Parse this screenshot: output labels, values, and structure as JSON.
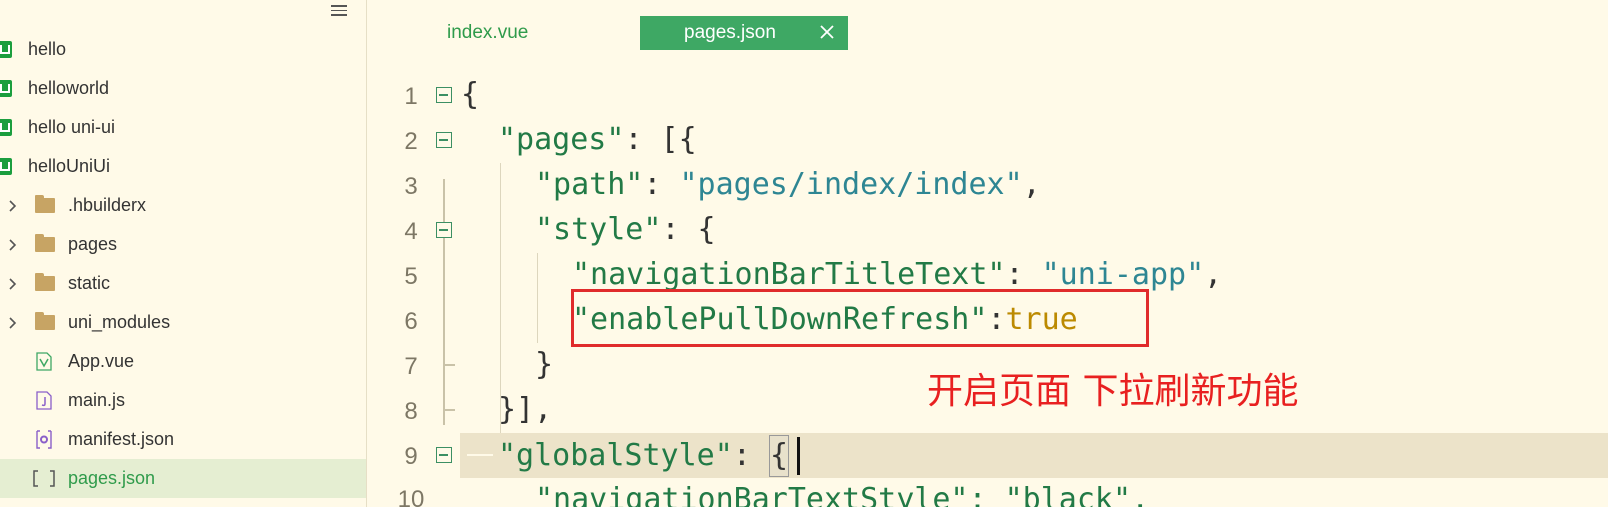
{
  "sidebar": {
    "items": [
      {
        "label": "hello",
        "kind": "project",
        "icon": "uni-project-icon"
      },
      {
        "label": "helloworld",
        "kind": "project",
        "icon": "uni-project-icon"
      },
      {
        "label": "hello uni-ui",
        "kind": "project",
        "icon": "uni-project-icon"
      },
      {
        "label": "helloUniUi",
        "kind": "project",
        "icon": "uni-project-icon"
      },
      {
        "label": ".hbuilderx",
        "kind": "folder",
        "icon": "folder-icon"
      },
      {
        "label": "pages",
        "kind": "folder",
        "icon": "folder-icon"
      },
      {
        "label": "static",
        "kind": "folder",
        "icon": "folder-icon"
      },
      {
        "label": "uni_modules",
        "kind": "folder",
        "icon": "folder-icon"
      },
      {
        "label": "App.vue",
        "kind": "file",
        "icon": "vue-file-icon"
      },
      {
        "label": "main.js",
        "kind": "file",
        "icon": "js-file-icon"
      },
      {
        "label": "manifest.json",
        "kind": "file",
        "icon": "manifest-file-icon"
      },
      {
        "label": "pages.json",
        "kind": "file",
        "icon": "json-file-icon",
        "active": true
      }
    ]
  },
  "tabs": [
    {
      "label": "index.vue",
      "active": false
    },
    {
      "label": "pages.json",
      "active": true
    }
  ],
  "code": {
    "line_numbers": [
      "1",
      "2",
      "3",
      "4",
      "5",
      "6",
      "7",
      "8",
      "9"
    ],
    "l1": {
      "brace": "{"
    },
    "l2": {
      "key": "\"pages\"",
      "rest": ": [{"
    },
    "l3": {
      "key": "\"path\"",
      "colon": ": ",
      "value": "\"pages/index/index\"",
      "comma": ","
    },
    "l4": {
      "key": "\"style\"",
      "rest": ": {"
    },
    "l5": {
      "key": "\"navigationBarTitleText\"",
      "colon": ": ",
      "value": "\"uni-app\"",
      "comma": ","
    },
    "l6": {
      "key": "\"enablePullDownRefresh\"",
      "colon": ":",
      "value": "true"
    },
    "l7": {
      "brace": "}"
    },
    "l8": {
      "text": "}],"
    },
    "l9": {
      "key": "\"globalStyle\"",
      "colon": ": ",
      "brace": "{"
    },
    "l10": {
      "partial": "\"navigationBarTextStyle\": \"black\","
    }
  },
  "annotation": {
    "text": "开启页面 下拉刷新功能"
  },
  "colors": {
    "accent_green": "#3ea864",
    "highlight_red": "#e02b2b",
    "editor_bg": "#fffae8"
  }
}
